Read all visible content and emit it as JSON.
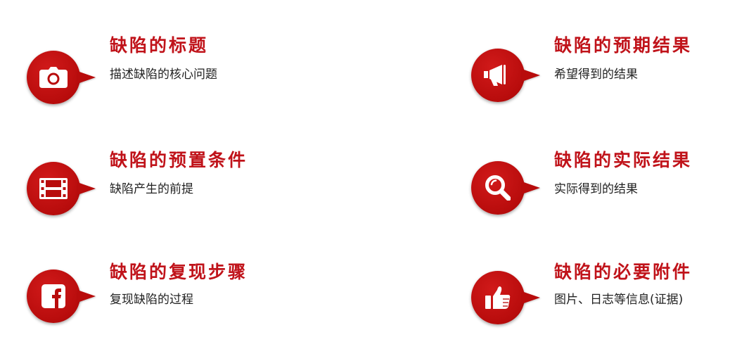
{
  "colors": {
    "accent": "#c0131a",
    "badge": "#b80c0c",
    "text": "#222222",
    "icon": "#ffffff"
  },
  "items": [
    {
      "icon": "camera-icon",
      "title": "缺陷的标题",
      "desc": "描述缺陷的核心问题"
    },
    {
      "icon": "film-icon",
      "title": "缺陷的预置条件",
      "desc": "缺陷产生的前提"
    },
    {
      "icon": "facebook-icon",
      "title": "缺陷的复现步骤",
      "desc": "复现缺陷的过程"
    },
    {
      "icon": "megaphone-icon",
      "title": "缺陷的预期结果",
      "desc": "希望得到的结果"
    },
    {
      "icon": "magnifier-icon",
      "title": "缺陷的实际结果",
      "desc": "实际得到的结果"
    },
    {
      "icon": "thumbs-up-icon",
      "title": "缺陷的必要附件",
      "desc": "图片、日志等信息(证据)"
    }
  ]
}
